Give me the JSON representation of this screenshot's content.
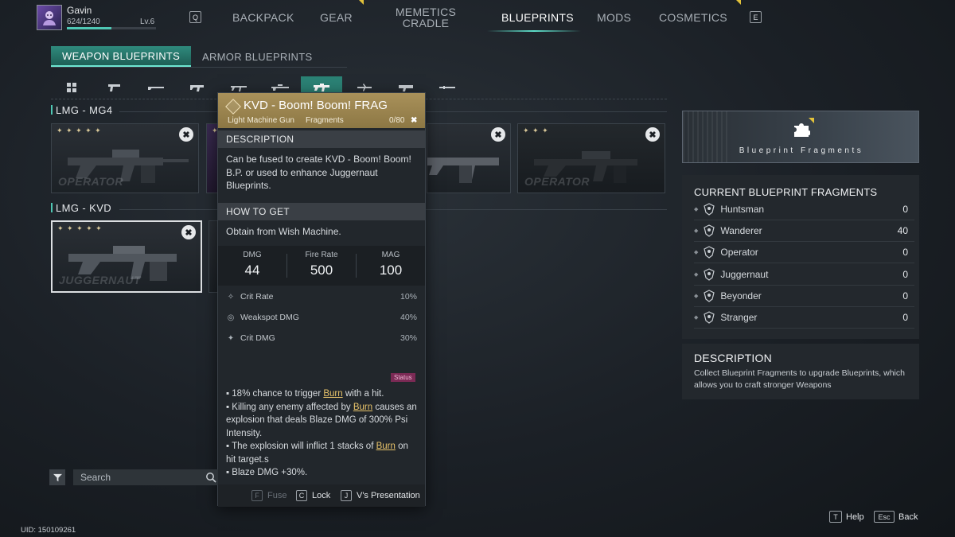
{
  "player": {
    "name": "Gavin",
    "xp": "624/1240",
    "xp_fraction": 0.503,
    "level": "Lv.6"
  },
  "nav": {
    "key_left": "Q",
    "key_right": "E",
    "items": [
      {
        "label": "BACKPACK",
        "active": false
      },
      {
        "label": "GEAR",
        "active": false,
        "notify": true
      },
      {
        "label": "MEMETICS",
        "label2": "CRADLE",
        "active": false
      },
      {
        "label": "BLUEPRINTS",
        "active": true
      },
      {
        "label": "MODS",
        "active": false
      },
      {
        "label": "COSMETICS",
        "active": false,
        "notify": true
      }
    ]
  },
  "subtabs": [
    {
      "label": "WEAPON BLUEPRINTS",
      "active": true
    },
    {
      "label": "ARMOR BLUEPRINTS",
      "active": false
    }
  ],
  "categories": {
    "icons": [
      "all-grid-icon",
      "pistol-icon",
      "shotgun-icon",
      "smg-icon",
      "assault-rifle-icon",
      "sniper-icon",
      "lmg-icon",
      "crossbow-icon",
      "launcher-icon",
      "melee-icon"
    ],
    "active_index": 6
  },
  "groups": [
    {
      "title": "LMG - MG4",
      "cards": [
        {
          "stars": "✦ ✦ ✦ ✦ ✦",
          "rarity": "OPERATOR",
          "style": "normal"
        },
        {
          "stars": "✦ ✦ ✦",
          "rarity": "",
          "style": "purple"
        },
        {
          "stars": "✦ ✦ ✦",
          "rarity": "OPERATOR",
          "style": "dark"
        }
      ]
    },
    {
      "title": "LMG - KVD",
      "cards": [
        {
          "stars": "✦ ✦ ✦ ✦ ✦",
          "rarity": "JUGGERNAUT",
          "style": "normal",
          "selected": true
        }
      ]
    }
  ],
  "tooltip": {
    "title": "KVD - Boom! Boom! FRAG",
    "type": "Light Machine Gun",
    "category": "Fragments",
    "count": "0/80",
    "description_header": "DESCRIPTION",
    "description": "Can be fused to create KVD - Boom! Boom! B.P. or used to enhance Juggernaut Blueprints.",
    "how_to_get_header": "HOW TO GET",
    "how_to_get": "Obtain from Wish Machine.",
    "stats": [
      {
        "label": "DMG",
        "value": "44"
      },
      {
        "label": "Fire Rate",
        "value": "500"
      },
      {
        "label": "MAG",
        "value": "100"
      }
    ],
    "attributes": [
      {
        "label": "Crit Rate",
        "value": "10%",
        "icon": "crit-rate-icon"
      },
      {
        "label": "Weakspot DMG",
        "value": "40%",
        "icon": "weakspot-icon"
      },
      {
        "label": "Crit DMG",
        "value": "30%",
        "icon": "crit-dmg-icon"
      }
    ],
    "status_tag": "Status",
    "effects": {
      "e1_pre": "▪ 18% chance to trigger ",
      "e1_kw": "Burn",
      "e1_post": " with a hit.",
      "e2_pre": "▪ Killing any enemy affected by ",
      "e2_kw": "Burn",
      "e2_post": " causes an explosion that deals Blaze DMG of 300% Psi Intensity.",
      "e3_pre": "▪ The explosion will inflict 1 stacks of ",
      "e3_kw": "Burn",
      "e3_post": " on hit target.s",
      "e4": "▪ Blaze DMG +30%."
    },
    "footer": [
      {
        "key": "F",
        "label": "Fuse",
        "enabled": false
      },
      {
        "key": "C",
        "label": "Lock",
        "enabled": true
      },
      {
        "key": "J",
        "label": "V's Presentation",
        "enabled": true
      }
    ]
  },
  "right_panel": {
    "banner_title": "Blueprint Fragments",
    "fragments_title": "CURRENT BLUEPRINT FRAGMENTS",
    "fragments": [
      {
        "name": "Huntsman",
        "value": "0"
      },
      {
        "name": "Wanderer",
        "value": "40"
      },
      {
        "name": "Operator",
        "value": "0"
      },
      {
        "name": "Juggernaut",
        "value": "0"
      },
      {
        "name": "Beyonder",
        "value": "0"
      },
      {
        "name": "Stranger",
        "value": "0"
      }
    ],
    "description_title": "DESCRIPTION",
    "description": "Collect Blueprint Fragments to upgrade Blueprints, which allows you to craft stronger Weapons"
  },
  "search": {
    "placeholder": "Search",
    "value": ""
  },
  "uid": "UID: 150109261",
  "hints": [
    {
      "key": "T",
      "label": "Help"
    },
    {
      "key": "Esc",
      "label": "Back"
    }
  ],
  "colors": {
    "accent": "#4fc7b4",
    "gold": "#a9915a",
    "burn": "#e8c36a"
  }
}
